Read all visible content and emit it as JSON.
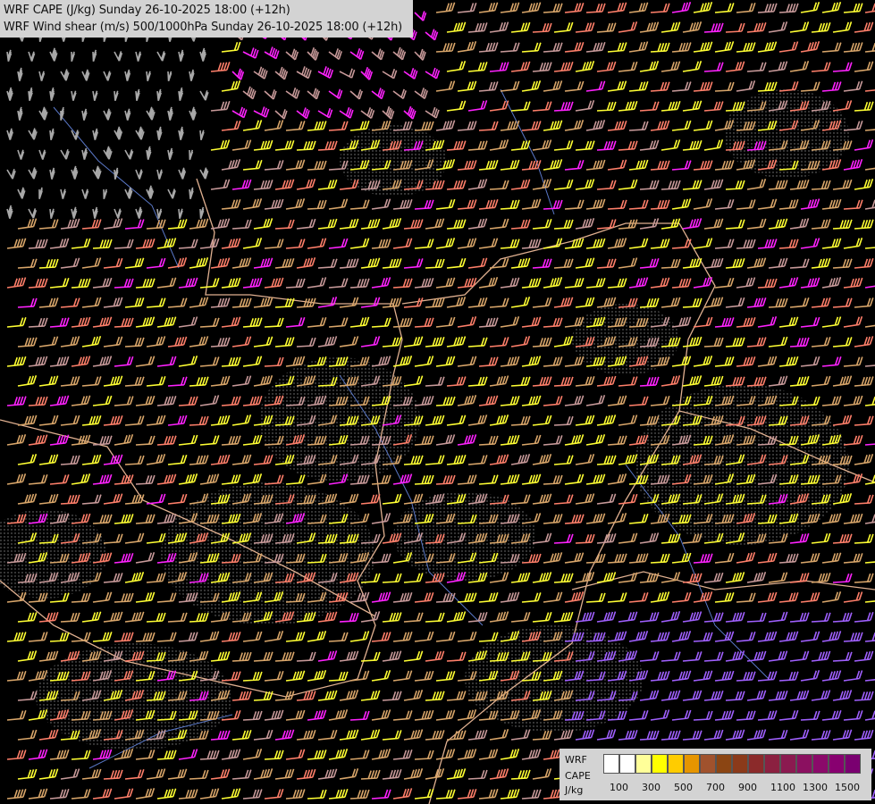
{
  "header": {
    "line1": "WRF CAPE (J/kg) Sunday 26-10-2025 18:00 (+12h)",
    "line2": "WRF Wind shear (m/s) 500/1000hPa Sunday 26-10-2025 18:00 (+12h)"
  },
  "legend": {
    "model": "WRF",
    "field": "CAPE",
    "unit": "J/kg",
    "colors": [
      "#ffffff",
      "#ffffff",
      "#ffff99",
      "#ffff00",
      "#ffcc00",
      "#e69500",
      "#a0522d",
      "#8b4513",
      "#8b3a1a",
      "#8b2a2a",
      "#8b2040",
      "#8b1a50",
      "#8b1060",
      "#8b0a6a",
      "#880070",
      "#7a0070"
    ],
    "ticks": [
      "100",
      "300",
      "500",
      "700",
      "900",
      "1100",
      "1300",
      "1500"
    ]
  },
  "map": {
    "wind_barb_colors": {
      "low": "#c89a9a",
      "grey": "#a8a8a8",
      "tan": "#d9a66a",
      "salmon": "#ff7f6a",
      "yellow": "#ffff33",
      "magenta": "#ff22ff",
      "violet": "#a060ff"
    },
    "border_color": "#e0b090",
    "river_color": "#5a78c8"
  }
}
